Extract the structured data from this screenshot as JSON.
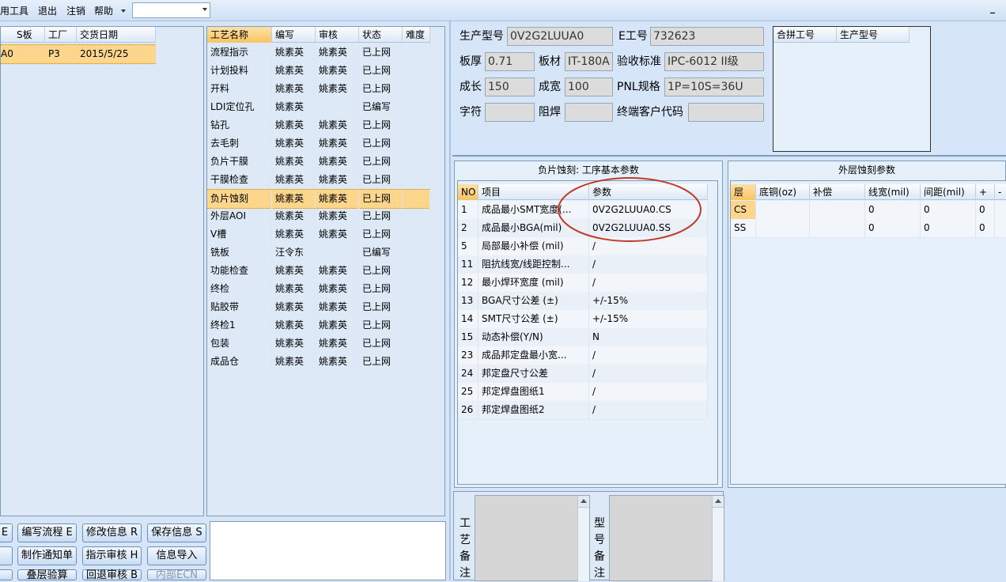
{
  "menu": {
    "items": [
      "用工具",
      "退出",
      "注销",
      "帮助"
    ],
    "combo_value": "",
    "window_button": "_"
  },
  "orders": {
    "columns": [
      "S板",
      "工厂",
      "交货日期"
    ],
    "rows": [
      {
        "id_fragment": "A0",
        "board": "",
        "factory": "P3",
        "date": "2015/5/25"
      }
    ]
  },
  "process": {
    "columns": [
      "工艺名称",
      "编写",
      "审核",
      "状态",
      "难度"
    ],
    "rows": [
      {
        "name": "流程指示",
        "writer": "姚素英",
        "reviewer": "姚素英",
        "status": "已上网",
        "difficulty": ""
      },
      {
        "name": "计划投料",
        "writer": "姚素英",
        "reviewer": "姚素英",
        "status": "已上网",
        "difficulty": ""
      },
      {
        "name": "开料",
        "writer": "姚素英",
        "reviewer": "姚素英",
        "status": "已上网",
        "difficulty": ""
      },
      {
        "name": "LDI定位孔",
        "writer": "姚素英",
        "reviewer": "",
        "status": "已编写",
        "difficulty": ""
      },
      {
        "name": "钻孔",
        "writer": "姚素英",
        "reviewer": "姚素英",
        "status": "已上网",
        "difficulty": ""
      },
      {
        "name": "去毛刺",
        "writer": "姚素英",
        "reviewer": "姚素英",
        "status": "已上网",
        "difficulty": ""
      },
      {
        "name": "负片干膜",
        "writer": "姚素英",
        "reviewer": "姚素英",
        "status": "已上网",
        "difficulty": ""
      },
      {
        "name": "干膜检查",
        "writer": "姚素英",
        "reviewer": "姚素英",
        "status": "已上网",
        "difficulty": ""
      },
      {
        "name": "负片蚀刻",
        "writer": "姚素英",
        "reviewer": "姚素英",
        "status": "已上网",
        "difficulty": ""
      },
      {
        "name": "外层AOI",
        "writer": "姚素英",
        "reviewer": "姚素英",
        "status": "已上网",
        "difficulty": ""
      },
      {
        "name": "V槽",
        "writer": "姚素英",
        "reviewer": "姚素英",
        "status": "已上网",
        "difficulty": ""
      },
      {
        "name": "铣板",
        "writer": "汪令东",
        "reviewer": "",
        "status": "已编写",
        "difficulty": ""
      },
      {
        "name": "功能检查",
        "writer": "姚素英",
        "reviewer": "姚素英",
        "status": "已上网",
        "difficulty": ""
      },
      {
        "name": "终检",
        "writer": "姚素英",
        "reviewer": "姚素英",
        "status": "已上网",
        "difficulty": ""
      },
      {
        "name": "贴胶带",
        "writer": "姚素英",
        "reviewer": "姚素英",
        "status": "已上网",
        "difficulty": ""
      },
      {
        "name": "终检1",
        "writer": "姚素英",
        "reviewer": "姚素英",
        "status": "已上网",
        "difficulty": ""
      },
      {
        "name": "包装",
        "writer": "姚素英",
        "reviewer": "姚素英",
        "status": "已上网",
        "difficulty": ""
      },
      {
        "name": "成品仓",
        "writer": "姚素英",
        "reviewer": "姚素英",
        "status": "已上网",
        "difficulty": ""
      }
    ]
  },
  "info": {
    "model_label": "生产型号",
    "model_value": "0V2G2LUUA0",
    "eno_label": "E工号",
    "eno_value": "732623",
    "thickness_label": "板厚",
    "thickness_value": "0.71",
    "material_label": "板材",
    "material_value": "IT-180A",
    "standard_label": "验收标准",
    "standard_value": "IPC-6012 II级",
    "length_label": "成长",
    "length_value": "150",
    "width_label": "成宽",
    "width_value": "100",
    "pnl_label": "PNL规格",
    "pnl_value": "1P=10S=36U",
    "char_label": "字符",
    "char_value": "",
    "solder_label": "阻焊",
    "solder_value": "",
    "customer_label": "终端客户代码",
    "customer_value": ""
  },
  "combine": {
    "columns": [
      "合拼工号",
      "生产型号"
    ]
  },
  "params": {
    "title": "负片蚀刻: 工序基本参数",
    "columns": [
      "NO",
      "项目",
      "参数"
    ],
    "rows": [
      {
        "no": "1",
        "item": "成品最小SMT宽度(...",
        "value": "0V2G2LUUA0.CS"
      },
      {
        "no": "2",
        "item": "成品最小BGA(mil)",
        "value": "0V2G2LUUA0.SS"
      },
      {
        "no": "5",
        "item": "局部最小补偿 (mil)",
        "value": "/"
      },
      {
        "no": "11",
        "item": "阻抗线宽/线距控制...",
        "value": "/"
      },
      {
        "no": "12",
        "item": "最小焊环宽度 (mil)",
        "value": "/"
      },
      {
        "no": "13",
        "item": "BGA尺寸公差 (±)",
        "value": "+/-15%"
      },
      {
        "no": "14",
        "item": "SMT尺寸公差 (±)",
        "value": "+/-15%"
      },
      {
        "no": "15",
        "item": "动态补偿(Y/N)",
        "value": "N"
      },
      {
        "no": "23",
        "item": "成品邦定盘最小宽...",
        "value": "/"
      },
      {
        "no": "24",
        "item": "邦定盘尺寸公差",
        "value": "/"
      },
      {
        "no": "25",
        "item": "邦定焊盘图纸1",
        "value": "/"
      },
      {
        "no": "26",
        "item": "邦定焊盘图纸2",
        "value": "/"
      }
    ]
  },
  "outer": {
    "title": "外层蚀刻参数",
    "columns": [
      "层",
      "底铜(oz)",
      "补偿",
      "线宽(mil)",
      "间距(mil)",
      "+",
      "-"
    ],
    "rows": [
      {
        "layer": "CS",
        "base": "",
        "comp": "",
        "line": "0",
        "space": "0",
        "plus": "0"
      },
      {
        "layer": "SS",
        "base": "",
        "comp": "",
        "line": "0",
        "space": "0",
        "plus": "0"
      }
    ]
  },
  "notes": {
    "process_label": "工艺备注",
    "model_label": "型号备注"
  },
  "buttons": {
    "row1": [
      "E",
      "编写流程 E",
      "修改信息 R",
      "保存信息 S"
    ],
    "row2": [
      "",
      "制作通知单",
      "指示审核 H",
      "信息导入"
    ],
    "row3": [
      "",
      "叠层验算",
      "回退审核 B",
      "内部ECN"
    ]
  },
  "colors": {
    "selection": "#fbd68c",
    "panel": "#e6f0fb",
    "annotation_circle": "#c0392b"
  }
}
